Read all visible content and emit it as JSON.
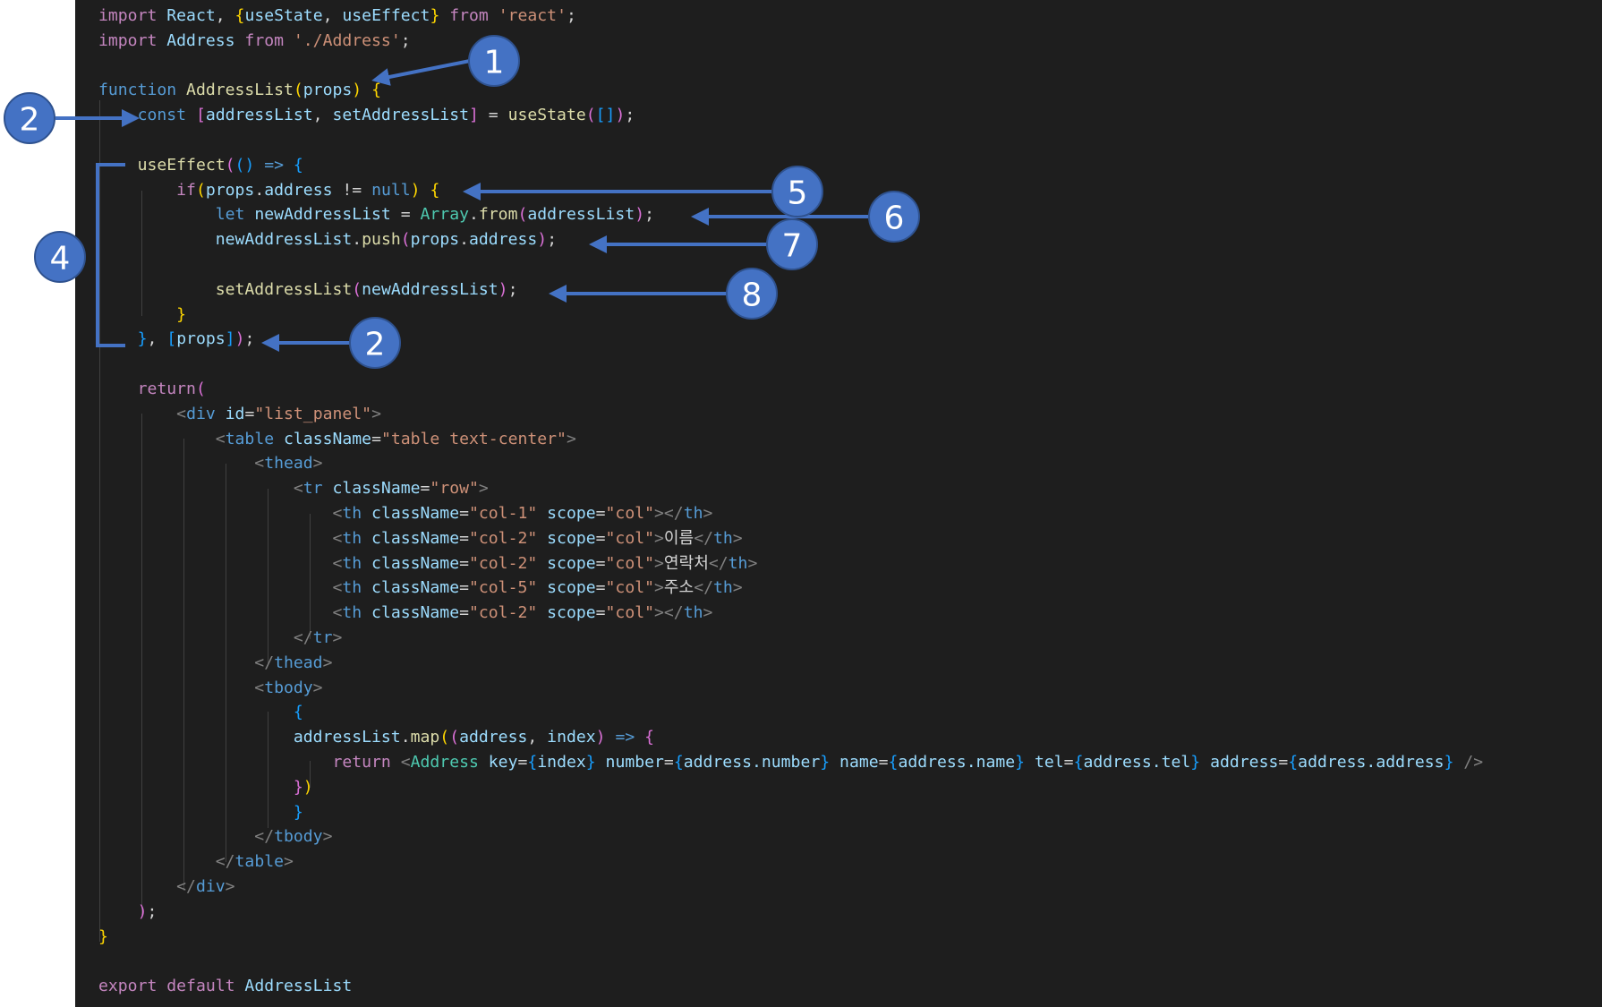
{
  "colors": {
    "background": "#1e1e1e",
    "keyword": "#569cd6",
    "control": "#c586c0",
    "function": "#dcdcaa",
    "variable": "#9cdcfe",
    "string": "#ce9178",
    "type": "#4ec9b0",
    "plain": "#d4d4d4",
    "tag_bracket": "#808080",
    "bracket_gold": "#ffd700",
    "bracket_pink": "#da70d6",
    "bracket_blue": "#179fff",
    "annotation_blue": "#4472c4"
  },
  "code": {
    "lines": [
      [
        [
          "import ",
          "control"
        ],
        [
          "React",
          "variable"
        ],
        [
          ", ",
          "plain"
        ],
        [
          "{",
          "bracket_gold"
        ],
        [
          "useState",
          "variable"
        ],
        [
          ", ",
          "plain"
        ],
        [
          "useEffect",
          "variable"
        ],
        [
          "}",
          "bracket_gold"
        ],
        [
          " from ",
          "control"
        ],
        [
          "'react'",
          "string"
        ],
        [
          ";",
          "plain"
        ]
      ],
      [
        [
          "import ",
          "control"
        ],
        [
          "Address ",
          "variable"
        ],
        [
          "from ",
          "control"
        ],
        [
          "'./Address'",
          "string"
        ],
        [
          ";",
          "plain"
        ]
      ],
      [],
      [
        [
          "function ",
          "keyword"
        ],
        [
          "AddressList",
          "function"
        ],
        [
          "(",
          "bracket_gold"
        ],
        [
          "props",
          "variable"
        ],
        [
          ")",
          "bracket_gold"
        ],
        [
          " ",
          "plain"
        ],
        [
          "{",
          "bracket_gold"
        ]
      ],
      [
        [
          "    const ",
          "keyword"
        ],
        [
          "[",
          "bracket_pink"
        ],
        [
          "addressList",
          "variable"
        ],
        [
          ", ",
          "plain"
        ],
        [
          "setAddressList",
          "variable"
        ],
        [
          "]",
          "bracket_pink"
        ],
        [
          " = ",
          "plain"
        ],
        [
          "useState",
          "function"
        ],
        [
          "(",
          "bracket_pink"
        ],
        [
          "[]",
          "bracket_blue"
        ],
        [
          ")",
          "bracket_pink"
        ],
        [
          ";",
          "plain"
        ]
      ],
      [],
      [
        [
          "    ",
          "plain"
        ],
        [
          "useEffect",
          "function"
        ],
        [
          "(",
          "bracket_pink"
        ],
        [
          "()",
          "bracket_blue"
        ],
        [
          " => ",
          "keyword"
        ],
        [
          "{",
          "bracket_blue"
        ]
      ],
      [
        [
          "        ",
          "plain"
        ],
        [
          "if",
          "control"
        ],
        [
          "(",
          "bracket_gold"
        ],
        [
          "props",
          "variable"
        ],
        [
          ".",
          "plain"
        ],
        [
          "address",
          "variable"
        ],
        [
          " != ",
          "plain"
        ],
        [
          "null",
          "keyword"
        ],
        [
          ")",
          "bracket_gold"
        ],
        [
          " ",
          "plain"
        ],
        [
          "{",
          "bracket_gold"
        ]
      ],
      [
        [
          "            ",
          "plain"
        ],
        [
          "let ",
          "keyword"
        ],
        [
          "newAddressList",
          "variable"
        ],
        [
          " = ",
          "plain"
        ],
        [
          "Array",
          "type"
        ],
        [
          ".",
          "plain"
        ],
        [
          "from",
          "function"
        ],
        [
          "(",
          "bracket_pink"
        ],
        [
          "addressList",
          "variable"
        ],
        [
          ")",
          "bracket_pink"
        ],
        [
          ";",
          "plain"
        ]
      ],
      [
        [
          "            ",
          "plain"
        ],
        [
          "newAddressList",
          "variable"
        ],
        [
          ".",
          "plain"
        ],
        [
          "push",
          "function"
        ],
        [
          "(",
          "bracket_pink"
        ],
        [
          "props",
          "variable"
        ],
        [
          ".",
          "plain"
        ],
        [
          "address",
          "variable"
        ],
        [
          ")",
          "bracket_pink"
        ],
        [
          ";",
          "plain"
        ]
      ],
      [],
      [
        [
          "            ",
          "plain"
        ],
        [
          "setAddressList",
          "function"
        ],
        [
          "(",
          "bracket_pink"
        ],
        [
          "newAddressList",
          "variable"
        ],
        [
          ")",
          "bracket_pink"
        ],
        [
          ";",
          "plain"
        ]
      ],
      [
        [
          "        ",
          "plain"
        ],
        [
          "}",
          "bracket_gold"
        ]
      ],
      [
        [
          "    ",
          "plain"
        ],
        [
          "}",
          "bracket_blue"
        ],
        [
          ", ",
          "plain"
        ],
        [
          "[",
          "bracket_blue"
        ],
        [
          "props",
          "variable"
        ],
        [
          "]",
          "bracket_blue"
        ],
        [
          ")",
          "bracket_pink"
        ],
        [
          ";",
          "plain"
        ]
      ],
      [],
      [
        [
          "    ",
          "plain"
        ],
        [
          "return",
          "control"
        ],
        [
          "(",
          "bracket_pink"
        ]
      ],
      [
        [
          "        ",
          "plain"
        ],
        [
          "<",
          "tag_bracket"
        ],
        [
          "div ",
          "keyword"
        ],
        [
          "id",
          "variable"
        ],
        [
          "=",
          "plain"
        ],
        [
          "\"list_panel\"",
          "string"
        ],
        [
          ">",
          "tag_bracket"
        ]
      ],
      [
        [
          "            ",
          "plain"
        ],
        [
          "<",
          "tag_bracket"
        ],
        [
          "table ",
          "keyword"
        ],
        [
          "className",
          "variable"
        ],
        [
          "=",
          "plain"
        ],
        [
          "\"table text-center\"",
          "string"
        ],
        [
          ">",
          "tag_bracket"
        ]
      ],
      [
        [
          "                ",
          "plain"
        ],
        [
          "<",
          "tag_bracket"
        ],
        [
          "thead",
          "keyword"
        ],
        [
          ">",
          "tag_bracket"
        ]
      ],
      [
        [
          "                    ",
          "plain"
        ],
        [
          "<",
          "tag_bracket"
        ],
        [
          "tr ",
          "keyword"
        ],
        [
          "className",
          "variable"
        ],
        [
          "=",
          "plain"
        ],
        [
          "\"row\"",
          "string"
        ],
        [
          ">",
          "tag_bracket"
        ]
      ],
      [
        [
          "                        ",
          "plain"
        ],
        [
          "<",
          "tag_bracket"
        ],
        [
          "th ",
          "keyword"
        ],
        [
          "className",
          "variable"
        ],
        [
          "=",
          "plain"
        ],
        [
          "\"col-1\" ",
          "string"
        ],
        [
          "scope",
          "variable"
        ],
        [
          "=",
          "plain"
        ],
        [
          "\"col\"",
          "string"
        ],
        [
          "></",
          "tag_bracket"
        ],
        [
          "th",
          "keyword"
        ],
        [
          ">",
          "tag_bracket"
        ]
      ],
      [
        [
          "                        ",
          "plain"
        ],
        [
          "<",
          "tag_bracket"
        ],
        [
          "th ",
          "keyword"
        ],
        [
          "className",
          "variable"
        ],
        [
          "=",
          "plain"
        ],
        [
          "\"col-2\" ",
          "string"
        ],
        [
          "scope",
          "variable"
        ],
        [
          "=",
          "plain"
        ],
        [
          "\"col\"",
          "string"
        ],
        [
          ">",
          "tag_bracket"
        ],
        [
          "이름",
          "plain"
        ],
        [
          "</",
          "tag_bracket"
        ],
        [
          "th",
          "keyword"
        ],
        [
          ">",
          "tag_bracket"
        ]
      ],
      [
        [
          "                        ",
          "plain"
        ],
        [
          "<",
          "tag_bracket"
        ],
        [
          "th ",
          "keyword"
        ],
        [
          "className",
          "variable"
        ],
        [
          "=",
          "plain"
        ],
        [
          "\"col-2\" ",
          "string"
        ],
        [
          "scope",
          "variable"
        ],
        [
          "=",
          "plain"
        ],
        [
          "\"col\"",
          "string"
        ],
        [
          ">",
          "tag_bracket"
        ],
        [
          "연락처",
          "plain"
        ],
        [
          "</",
          "tag_bracket"
        ],
        [
          "th",
          "keyword"
        ],
        [
          ">",
          "tag_bracket"
        ]
      ],
      [
        [
          "                        ",
          "plain"
        ],
        [
          "<",
          "tag_bracket"
        ],
        [
          "th ",
          "keyword"
        ],
        [
          "className",
          "variable"
        ],
        [
          "=",
          "plain"
        ],
        [
          "\"col-5\" ",
          "string"
        ],
        [
          "scope",
          "variable"
        ],
        [
          "=",
          "plain"
        ],
        [
          "\"col\"",
          "string"
        ],
        [
          ">",
          "tag_bracket"
        ],
        [
          "주소",
          "plain"
        ],
        [
          "</",
          "tag_bracket"
        ],
        [
          "th",
          "keyword"
        ],
        [
          ">",
          "tag_bracket"
        ]
      ],
      [
        [
          "                        ",
          "plain"
        ],
        [
          "<",
          "tag_bracket"
        ],
        [
          "th ",
          "keyword"
        ],
        [
          "className",
          "variable"
        ],
        [
          "=",
          "plain"
        ],
        [
          "\"col-2\" ",
          "string"
        ],
        [
          "scope",
          "variable"
        ],
        [
          "=",
          "plain"
        ],
        [
          "\"col\"",
          "string"
        ],
        [
          "></",
          "tag_bracket"
        ],
        [
          "th",
          "keyword"
        ],
        [
          ">",
          "tag_bracket"
        ]
      ],
      [
        [
          "                    ",
          "plain"
        ],
        [
          "</",
          "tag_bracket"
        ],
        [
          "tr",
          "keyword"
        ],
        [
          ">",
          "tag_bracket"
        ]
      ],
      [
        [
          "                ",
          "plain"
        ],
        [
          "</",
          "tag_bracket"
        ],
        [
          "thead",
          "keyword"
        ],
        [
          ">",
          "tag_bracket"
        ]
      ],
      [
        [
          "                ",
          "plain"
        ],
        [
          "<",
          "tag_bracket"
        ],
        [
          "tbody",
          "keyword"
        ],
        [
          ">",
          "tag_bracket"
        ]
      ],
      [
        [
          "                    ",
          "plain"
        ],
        [
          "{",
          "bracket_blue"
        ]
      ],
      [
        [
          "                    ",
          "plain"
        ],
        [
          "addressList",
          "variable"
        ],
        [
          ".",
          "plain"
        ],
        [
          "map",
          "function"
        ],
        [
          "(",
          "bracket_gold"
        ],
        [
          "(",
          "bracket_pink"
        ],
        [
          "address",
          "variable"
        ],
        [
          ", ",
          "plain"
        ],
        [
          "index",
          "variable"
        ],
        [
          ")",
          "bracket_pink"
        ],
        [
          " => ",
          "keyword"
        ],
        [
          "{",
          "bracket_pink"
        ]
      ],
      [
        [
          "                        ",
          "plain"
        ],
        [
          "return ",
          "control"
        ],
        [
          "<",
          "tag_bracket"
        ],
        [
          "Address ",
          "type"
        ],
        [
          "key",
          "variable"
        ],
        [
          "=",
          "plain"
        ],
        [
          "{",
          "bracket_blue"
        ],
        [
          "index",
          "variable"
        ],
        [
          "}",
          "bracket_blue"
        ],
        [
          " number",
          "variable"
        ],
        [
          "=",
          "plain"
        ],
        [
          "{",
          "bracket_blue"
        ],
        [
          "address.number",
          "variable"
        ],
        [
          "}",
          "bracket_blue"
        ],
        [
          " name",
          "variable"
        ],
        [
          "=",
          "plain"
        ],
        [
          "{",
          "bracket_blue"
        ],
        [
          "address.name",
          "variable"
        ],
        [
          "}",
          "bracket_blue"
        ],
        [
          " tel",
          "variable"
        ],
        [
          "=",
          "plain"
        ],
        [
          "{",
          "bracket_blue"
        ],
        [
          "address.tel",
          "variable"
        ],
        [
          "}",
          "bracket_blue"
        ],
        [
          " address",
          "variable"
        ],
        [
          "=",
          "plain"
        ],
        [
          "{",
          "bracket_blue"
        ],
        [
          "address.address",
          "variable"
        ],
        [
          "}",
          "bracket_blue"
        ],
        [
          " />",
          "tag_bracket"
        ]
      ],
      [
        [
          "                    ",
          "plain"
        ],
        [
          "}",
          "bracket_pink"
        ],
        [
          ")",
          "bracket_gold"
        ]
      ],
      [
        [
          "                    ",
          "plain"
        ],
        [
          "}",
          "bracket_blue"
        ]
      ],
      [
        [
          "                ",
          "plain"
        ],
        [
          "</",
          "tag_bracket"
        ],
        [
          "tbody",
          "keyword"
        ],
        [
          ">",
          "tag_bracket"
        ]
      ],
      [
        [
          "            ",
          "plain"
        ],
        [
          "</",
          "tag_bracket"
        ],
        [
          "table",
          "keyword"
        ],
        [
          ">",
          "tag_bracket"
        ]
      ],
      [
        [
          "        ",
          "plain"
        ],
        [
          "</",
          "tag_bracket"
        ],
        [
          "div",
          "keyword"
        ],
        [
          ">",
          "tag_bracket"
        ]
      ],
      [
        [
          "    ",
          "plain"
        ],
        [
          ")",
          "bracket_pink"
        ],
        [
          ";",
          "plain"
        ]
      ],
      [
        [
          "}",
          "bracket_gold"
        ]
      ],
      [],
      [
        [
          "export ",
          "control"
        ],
        [
          "default ",
          "control"
        ],
        [
          "AddressList",
          "variable"
        ]
      ]
    ]
  },
  "annotations": {
    "badge_1": "1",
    "badge_2a": "2",
    "badge_4": "4",
    "badge_5": "5",
    "badge_6": "6",
    "badge_7": "7",
    "badge_8": "8",
    "badge_2b": "2"
  }
}
